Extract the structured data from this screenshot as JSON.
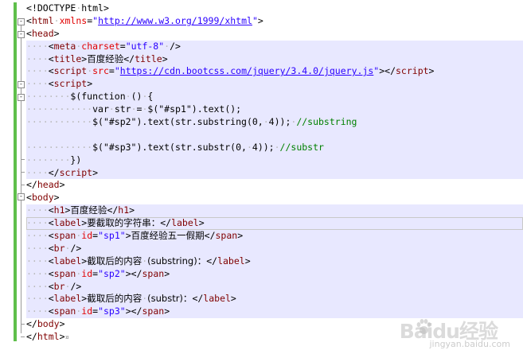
{
  "editor": {
    "lines": [
      {
        "indent": 0,
        "parts": [
          [
            "brk",
            "<"
          ],
          [
            "dt",
            "!DOCTYPE"
          ],
          [
            "ws",
            "·"
          ],
          [
            "dt",
            "html"
          ],
          [
            "brk",
            ">"
          ]
        ]
      },
      {
        "indent": 0,
        "parts": [
          [
            "brk",
            "<"
          ],
          [
            "tag",
            "html"
          ],
          [
            "ws",
            "·"
          ],
          [
            "attr",
            "xmlns"
          ],
          [
            "brk",
            "="
          ],
          [
            "val",
            "\""
          ],
          [
            "url",
            "http://www.w3.org/1999/xhtml"
          ],
          [
            "val",
            "\""
          ],
          [
            "brk",
            ">"
          ]
        ]
      },
      {
        "indent": 0,
        "parts": [
          [
            "brk",
            "<"
          ],
          [
            "tag",
            "head"
          ],
          [
            "brk",
            ">"
          ]
        ]
      },
      {
        "indent": 1,
        "parts": [
          [
            "brk",
            "<"
          ],
          [
            "tag",
            "meta"
          ],
          [
            "ws",
            "·"
          ],
          [
            "attr",
            "charset"
          ],
          [
            "brk",
            "="
          ],
          [
            "val",
            "\"utf-8\""
          ],
          [
            "ws",
            "·"
          ],
          [
            "brk",
            "/>"
          ]
        ]
      },
      {
        "indent": 1,
        "parts": [
          [
            "brk",
            "<"
          ],
          [
            "tag",
            "title"
          ],
          [
            "brk",
            ">"
          ],
          [
            "txt",
            "百度经验"
          ],
          [
            "brk",
            "</"
          ],
          [
            "tag",
            "title"
          ],
          [
            "brk",
            ">"
          ]
        ]
      },
      {
        "indent": 1,
        "parts": [
          [
            "brk",
            "<"
          ],
          [
            "tag",
            "script"
          ],
          [
            "ws",
            "·"
          ],
          [
            "attr",
            "src"
          ],
          [
            "brk",
            "="
          ],
          [
            "val",
            "\""
          ],
          [
            "url",
            "https://cdn.bootcss.com/jquery/3.4.0/jquery.js"
          ],
          [
            "val",
            "\""
          ],
          [
            "brk",
            "></"
          ],
          [
            "tag",
            "script"
          ],
          [
            "brk",
            ">"
          ]
        ]
      },
      {
        "indent": 1,
        "parts": [
          [
            "brk",
            "<"
          ],
          [
            "tag",
            "script"
          ],
          [
            "brk",
            ">"
          ]
        ]
      },
      {
        "indent": 2,
        "parts": [
          [
            "js",
            "$(function"
          ],
          [
            "ws",
            "·"
          ],
          [
            "js",
            "()"
          ],
          [
            "ws",
            "·"
          ],
          [
            "js",
            "{"
          ]
        ]
      },
      {
        "indent": 3,
        "parts": [
          [
            "js",
            "var"
          ],
          [
            "ws",
            "·"
          ],
          [
            "js",
            "str"
          ],
          [
            "ws",
            "·"
          ],
          [
            "js",
            "="
          ],
          [
            "ws",
            "·"
          ],
          [
            "js",
            "$(\"#sp1\").text();"
          ]
        ]
      },
      {
        "indent": 3,
        "parts": [
          [
            "js",
            "$(\"#sp2\").text(str.substring(0,"
          ],
          [
            "ws",
            "·"
          ],
          [
            "js",
            "4));"
          ],
          [
            "ws",
            "·"
          ],
          [
            "cm",
            "//substring"
          ]
        ]
      },
      {
        "indent": 0,
        "parts": []
      },
      {
        "indent": 3,
        "parts": [
          [
            "js",
            "$(\"#sp3\").text(str.substr(0,"
          ],
          [
            "ws",
            "·"
          ],
          [
            "js",
            "4));"
          ],
          [
            "ws",
            "·"
          ],
          [
            "cm",
            "//substr"
          ]
        ]
      },
      {
        "indent": 2,
        "parts": [
          [
            "js",
            "})"
          ]
        ]
      },
      {
        "indent": 1,
        "parts": [
          [
            "brk",
            "</"
          ],
          [
            "tag",
            "script"
          ],
          [
            "brk",
            ">"
          ]
        ]
      },
      {
        "indent": 0,
        "parts": [
          [
            "brk",
            "</"
          ],
          [
            "tag",
            "head"
          ],
          [
            "brk",
            ">"
          ]
        ]
      },
      {
        "indent": 0,
        "parts": [
          [
            "brk",
            "<"
          ],
          [
            "tag",
            "body"
          ],
          [
            "brk",
            ">"
          ]
        ]
      },
      {
        "indent": 1,
        "parts": [
          [
            "brk",
            "<"
          ],
          [
            "tag",
            "h1"
          ],
          [
            "brk",
            ">"
          ],
          [
            "txt",
            "百度经验"
          ],
          [
            "brk",
            "</"
          ],
          [
            "tag",
            "h1"
          ],
          [
            "brk",
            ">"
          ]
        ]
      },
      {
        "indent": 1,
        "parts": [
          [
            "brk",
            "<"
          ],
          [
            "tag",
            "label"
          ],
          [
            "brk",
            ">"
          ],
          [
            "txt",
            "要截取的字符串："
          ],
          [
            "brk",
            "</"
          ],
          [
            "tag",
            "label"
          ],
          [
            "brk",
            ">"
          ]
        ]
      },
      {
        "indent": 1,
        "parts": [
          [
            "brk",
            "<"
          ],
          [
            "tag",
            "span"
          ],
          [
            "ws",
            "·"
          ],
          [
            "attr",
            "id"
          ],
          [
            "brk",
            "="
          ],
          [
            "val",
            "\"sp1\""
          ],
          [
            "brk",
            ">"
          ],
          [
            "txt",
            "百度经验五一假期"
          ],
          [
            "brk",
            "</"
          ],
          [
            "tag",
            "span"
          ],
          [
            "brk",
            ">"
          ]
        ]
      },
      {
        "indent": 1,
        "parts": [
          [
            "brk",
            "<"
          ],
          [
            "tag",
            "br"
          ],
          [
            "ws",
            "·"
          ],
          [
            "brk",
            "/>"
          ]
        ]
      },
      {
        "indent": 1,
        "parts": [
          [
            "brk",
            "<"
          ],
          [
            "tag",
            "label"
          ],
          [
            "brk",
            ">"
          ],
          [
            "txt",
            "截取后的内容"
          ],
          [
            "ws",
            "·"
          ],
          [
            "txt",
            "(substring)："
          ],
          [
            "brk",
            "</"
          ],
          [
            "tag",
            "label"
          ],
          [
            "brk",
            ">"
          ]
        ]
      },
      {
        "indent": 1,
        "parts": [
          [
            "brk",
            "<"
          ],
          [
            "tag",
            "span"
          ],
          [
            "ws",
            "·"
          ],
          [
            "attr",
            "id"
          ],
          [
            "brk",
            "="
          ],
          [
            "val",
            "\"sp2\""
          ],
          [
            "brk",
            "></"
          ],
          [
            "tag",
            "span"
          ],
          [
            "brk",
            ">"
          ]
        ]
      },
      {
        "indent": 1,
        "parts": [
          [
            "brk",
            "<"
          ],
          [
            "tag",
            "br"
          ],
          [
            "ws",
            "·"
          ],
          [
            "brk",
            "/>"
          ]
        ]
      },
      {
        "indent": 1,
        "parts": [
          [
            "brk",
            "<"
          ],
          [
            "tag",
            "label"
          ],
          [
            "brk",
            ">"
          ],
          [
            "txt",
            "截取后的内容"
          ],
          [
            "ws",
            "·"
          ],
          [
            "txt",
            "(substr)："
          ],
          [
            "brk",
            "</"
          ],
          [
            "tag",
            "label"
          ],
          [
            "brk",
            ">"
          ]
        ]
      },
      {
        "indent": 1,
        "parts": [
          [
            "brk",
            "<"
          ],
          [
            "tag",
            "span"
          ],
          [
            "ws",
            "·"
          ],
          [
            "attr",
            "id"
          ],
          [
            "brk",
            "="
          ],
          [
            "val",
            "\"sp3\""
          ],
          [
            "brk",
            "></"
          ],
          [
            "tag",
            "span"
          ],
          [
            "brk",
            ">"
          ]
        ]
      },
      {
        "indent": 0,
        "parts": [
          [
            "brk",
            "</"
          ],
          [
            "tag",
            "body"
          ],
          [
            "brk",
            ">"
          ]
        ]
      },
      {
        "indent": 0,
        "parts": [
          [
            "brk",
            "</"
          ],
          [
            "tag",
            "html"
          ],
          [
            "brk",
            ">"
          ],
          [
            "eol",
            "¤"
          ]
        ]
      }
    ]
  },
  "watermark": {
    "logo": "Baidu经验",
    "url": "jingyan.baidu.com"
  },
  "colors": {
    "change_bar": "#5fbf4b",
    "highlight_block": "#e8e8ff",
    "tag": "#800000",
    "attribute": "#e10000",
    "value": "#2a00ff",
    "comment": "#008000"
  }
}
